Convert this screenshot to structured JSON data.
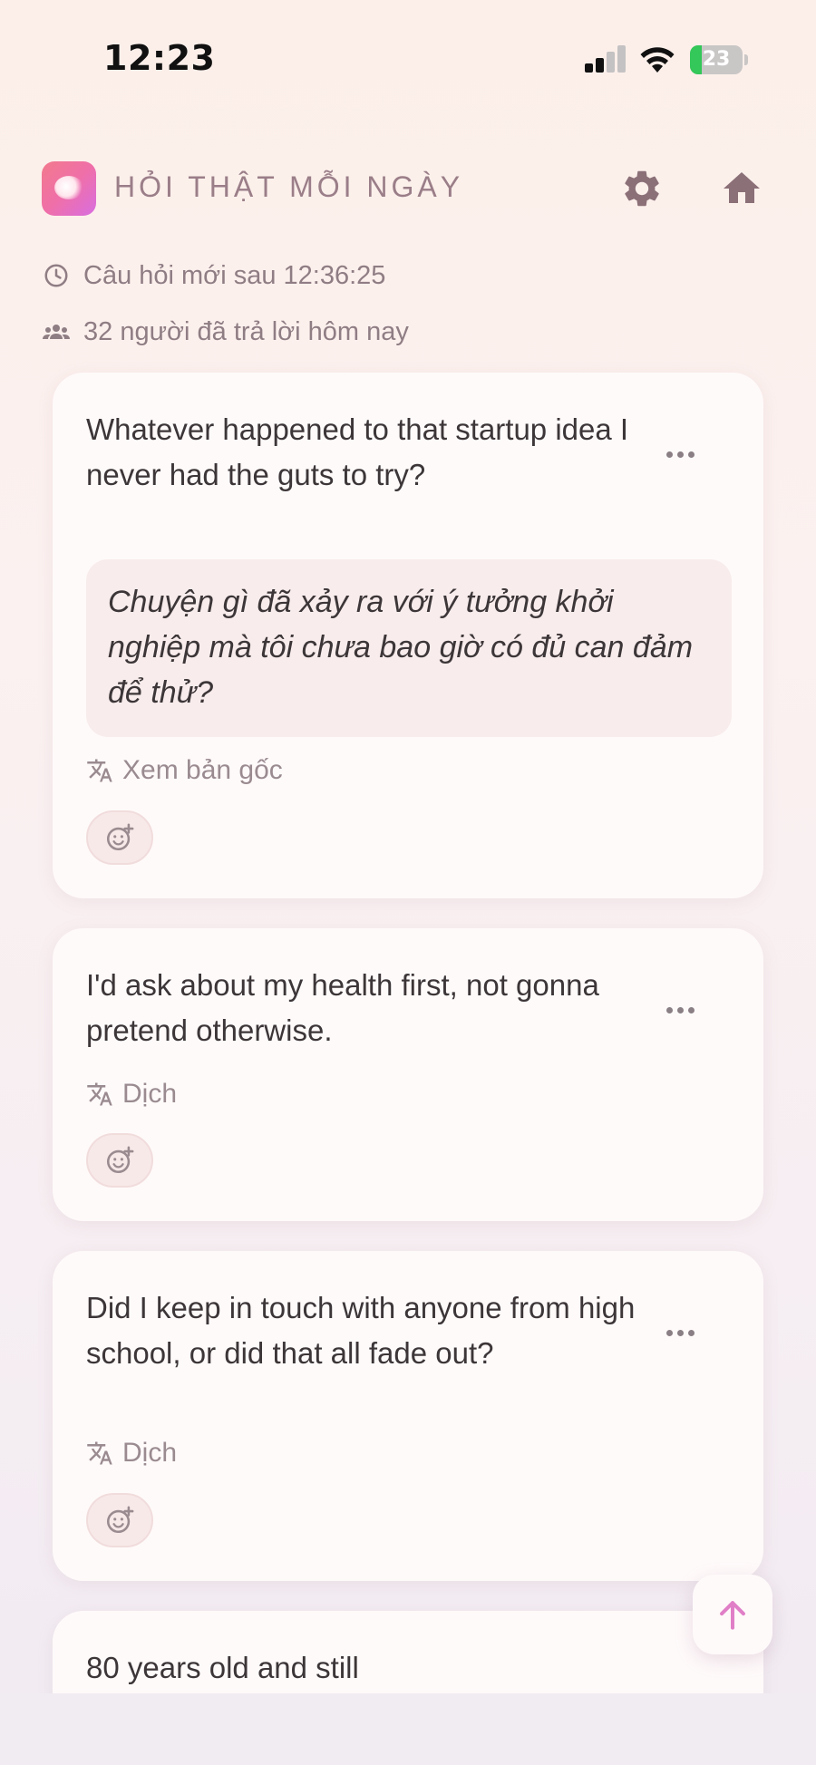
{
  "status_bar": {
    "time": "12:23",
    "battery_level": "23",
    "battery_fill_fraction": 0.23,
    "battery_color": "#34c759"
  },
  "header": {
    "title": "HỎI THẬT MỖI NGÀY",
    "logo_icon": "app-logo-gradient",
    "settings_icon": "gear-icon",
    "home_icon": "home-icon"
  },
  "info": {
    "countdown_text": "Câu hỏi mới sau 12:36:25",
    "answered_text": "32 người đã trả lời hôm nay"
  },
  "cards": [
    {
      "text": "Whatever happened to that startup idea I never had the guts to try?",
      "translation": "Chuyện gì đã xảy ra với ý tưởng khởi nghiệp mà tôi chưa bao giờ có đủ can đảm để thử?",
      "translate_label": "Xem bản gốc"
    },
    {
      "text": "I'd ask about my health first, not gonna pretend otherwise.",
      "translate_label": "Dịch"
    },
    {
      "text": "Did I keep in touch with anyone from high school, or did that all fade out?",
      "translate_label": "Dịch"
    },
    {
      "text": "80 years old and still"
    }
  ],
  "colors": {
    "accent": "#e07fc7",
    "muted_text": "#8f7d84",
    "card_bg": "#fffafa"
  }
}
